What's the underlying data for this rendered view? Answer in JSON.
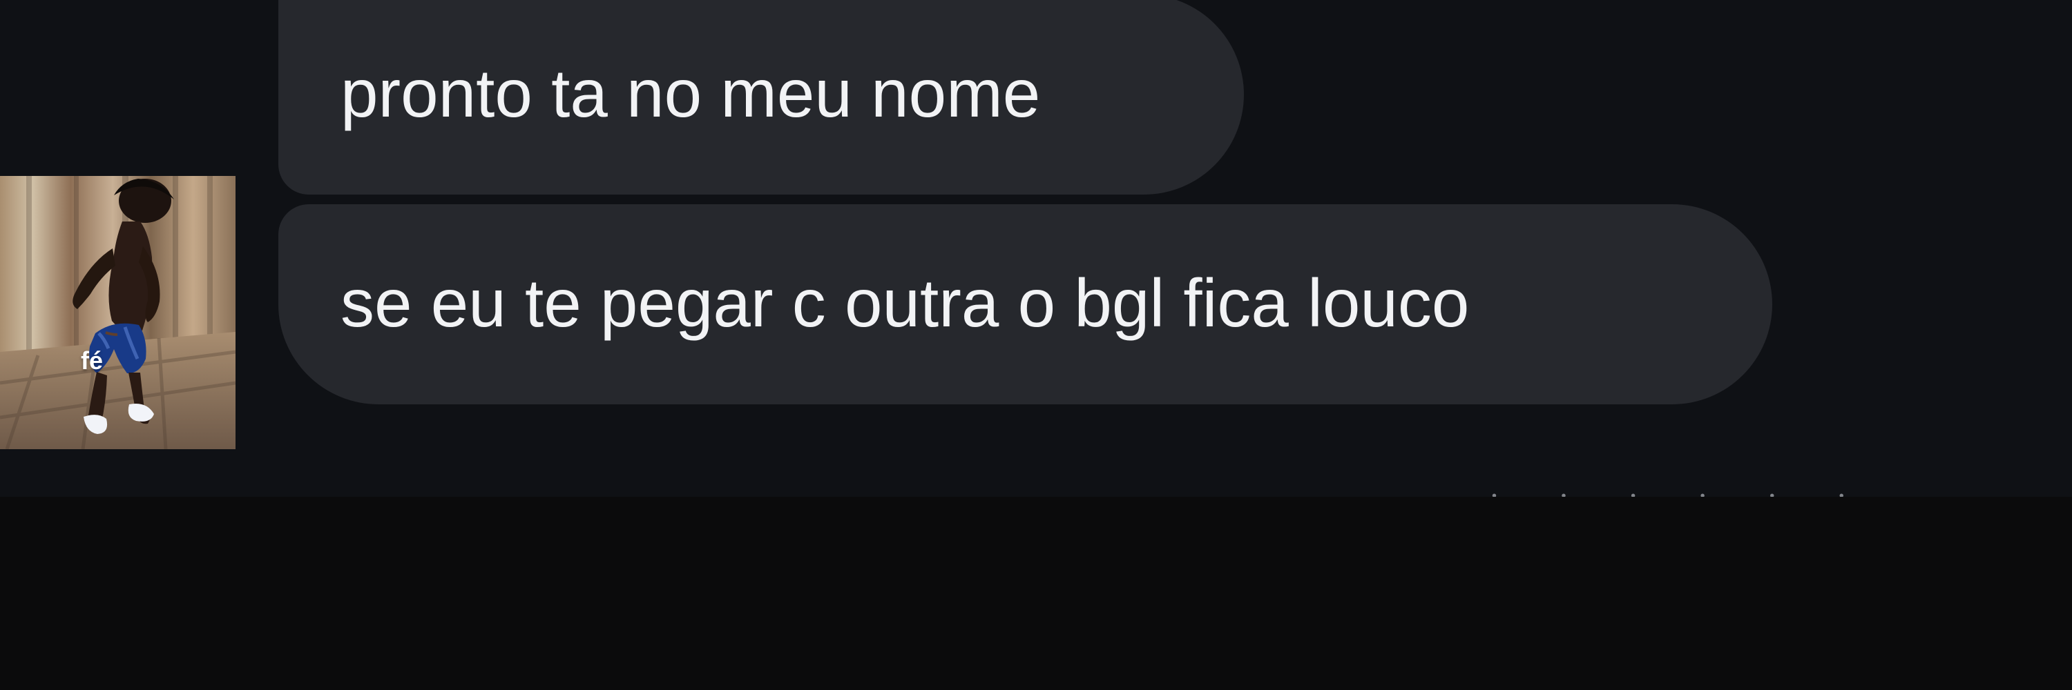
{
  "chat": {
    "messages": [
      {
        "text": "pronto ta no meu nome"
      },
      {
        "text": "se eu te pegar c outra o bgl fica louco"
      }
    ]
  },
  "avatar": {
    "caption": "fé"
  },
  "colors": {
    "chat_background": "#0f1115",
    "bubble_background": "#26282d",
    "bubble_text": "#f2f3f5",
    "lower_background": "#0b0b0c"
  }
}
